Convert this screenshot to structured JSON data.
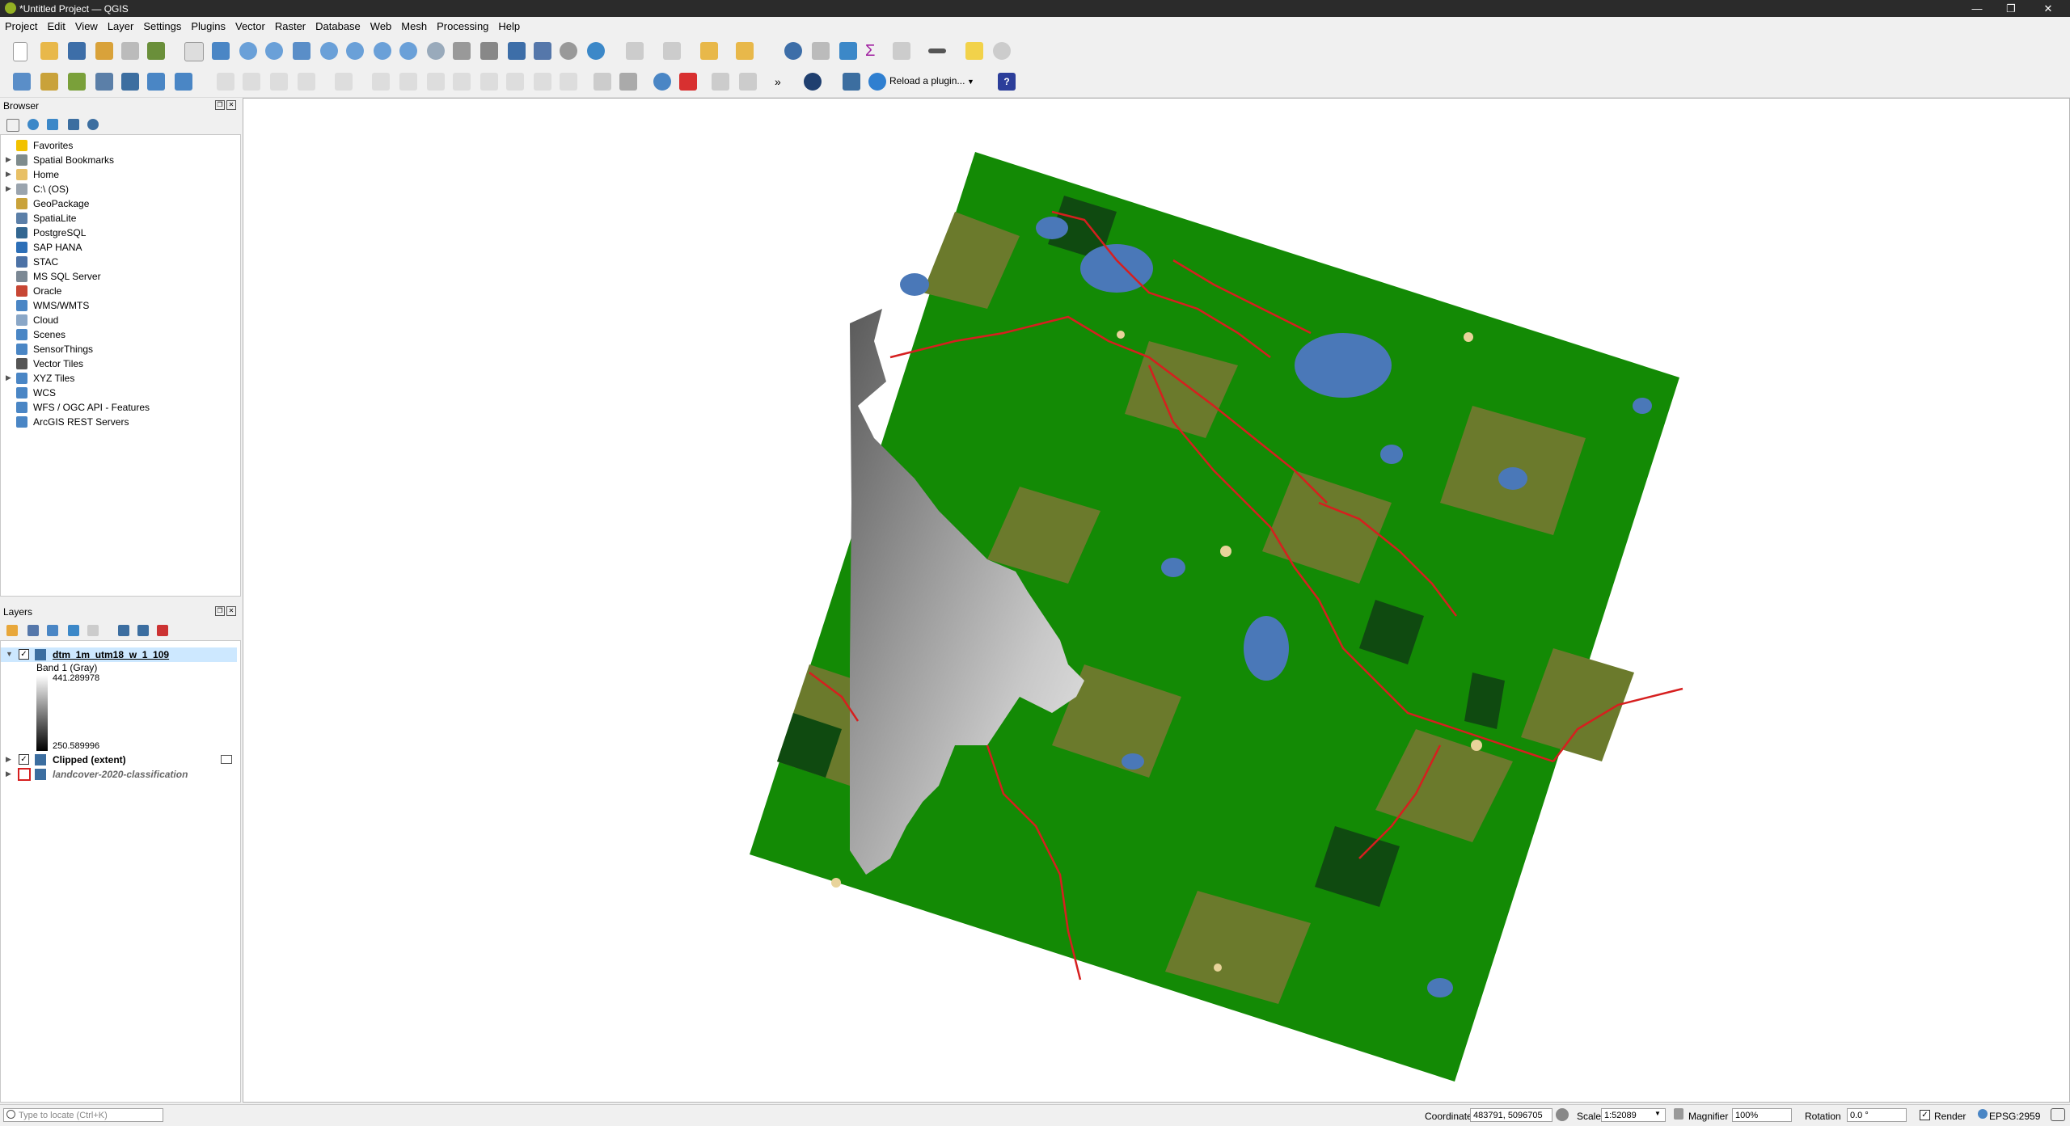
{
  "window": {
    "title": "*Untitled Project — QGIS"
  },
  "menu": [
    "Project",
    "Edit",
    "View",
    "Layer",
    "Settings",
    "Plugins",
    "Vector",
    "Raster",
    "Database",
    "Web",
    "Mesh",
    "Processing",
    "Help"
  ],
  "toolbar": {
    "reload_plugin_label": "Reload a plugin..."
  },
  "browser": {
    "title": "Browser",
    "items": [
      {
        "label": "Favorites",
        "icon": "star-icon",
        "expand": false,
        "color": "#f2c200"
      },
      {
        "label": "Spatial Bookmarks",
        "icon": "bookmark-icon",
        "expand": true,
        "color": "#7f8c8d"
      },
      {
        "label": "Home",
        "icon": "folder-icon",
        "expand": true,
        "color": "#e8c066"
      },
      {
        "label": "C:\\ (OS)",
        "icon": "drive-icon",
        "expand": true,
        "color": "#9aa4ae"
      },
      {
        "label": "GeoPackage",
        "icon": "geopackage-icon",
        "expand": false,
        "color": "#c9a23a"
      },
      {
        "label": "SpatiaLite",
        "icon": "spatialite-icon",
        "expand": false,
        "color": "#5b7fa8"
      },
      {
        "label": "PostgreSQL",
        "icon": "postgresql-icon",
        "expand": false,
        "color": "#336791"
      },
      {
        "label": "SAP HANA",
        "icon": "sap-hana-icon",
        "expand": false,
        "color": "#2d6fb7"
      },
      {
        "label": "STAC",
        "icon": "stac-icon",
        "expand": false,
        "color": "#4c72a6"
      },
      {
        "label": "MS SQL Server",
        "icon": "mssql-icon",
        "expand": false,
        "color": "#7b8894"
      },
      {
        "label": "Oracle",
        "icon": "oracle-icon",
        "expand": false,
        "color": "#c74634"
      },
      {
        "label": "WMS/WMTS",
        "icon": "wms-icon",
        "expand": false,
        "color": "#4a86c5"
      },
      {
        "label": "Cloud",
        "icon": "cloud-icon",
        "expand": false,
        "color": "#8aa7c7"
      },
      {
        "label": "Scenes",
        "icon": "scenes-icon",
        "expand": false,
        "color": "#4a86c5"
      },
      {
        "label": "SensorThings",
        "icon": "sensorthings-icon",
        "expand": false,
        "color": "#4a86c5"
      },
      {
        "label": "Vector Tiles",
        "icon": "vector-tiles-icon",
        "expand": false,
        "color": "#555555"
      },
      {
        "label": "XYZ Tiles",
        "icon": "xyz-tiles-icon",
        "expand": true,
        "color": "#4a86c5"
      },
      {
        "label": "WCS",
        "icon": "wcs-icon",
        "expand": false,
        "color": "#4a86c5"
      },
      {
        "label": "WFS / OGC API - Features",
        "icon": "wfs-icon",
        "expand": false,
        "color": "#4a86c5"
      },
      {
        "label": "ArcGIS REST Servers",
        "icon": "arcgis-icon",
        "expand": false,
        "color": "#4a86c5"
      }
    ]
  },
  "layers": {
    "title": "Layers",
    "items": [
      {
        "name": "dtm_1m_utm18_w_1_109",
        "checked": true,
        "expanded": true,
        "selected": true,
        "bold": true
      },
      {
        "name": "Clipped (extent)",
        "checked": true,
        "expanded": false,
        "selected": false,
        "bold": true
      },
      {
        "name": "landcover-2020-classification",
        "checked": false,
        "expanded": false,
        "selected": false,
        "bold": true,
        "italic": true
      }
    ],
    "legend": {
      "band": "Band 1 (Gray)",
      "max": "441.289978",
      "min": "250.589996"
    }
  },
  "status": {
    "locator_placeholder": "Type to locate (Ctrl+K)",
    "coordinate_label": "Coordinate",
    "coordinate_value": "483791, 5096705",
    "scale_label": "Scale",
    "scale_value": "1:52089",
    "magnifier_label": "Magnifier",
    "magnifier_value": "100%",
    "rotation_label": "Rotation",
    "rotation_value": "0.0 °",
    "render_label": "Render",
    "crs": "EPSG:2959"
  },
  "colors": {
    "green": "#138a05",
    "olive": "#6b7a2c",
    "dark": "#0f4a10",
    "water": "#4a78b8",
    "sand": "#e8d39a",
    "road": "#d61f1f"
  }
}
